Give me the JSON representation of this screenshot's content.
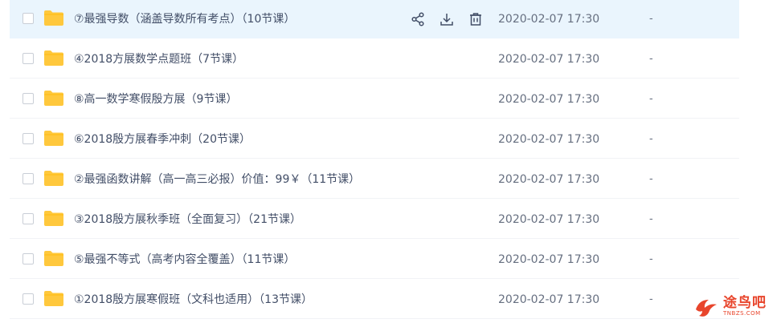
{
  "rows": [
    {
      "name": "⑦最强导数（涵盖导数所有考点）（10节课）",
      "date": "2020-02-07 17:30",
      "size": "-",
      "selected": true
    },
    {
      "name": "④2018方展数学点题班（7节课）",
      "date": "2020-02-07 17:30",
      "size": "-"
    },
    {
      "name": "⑧高一数学寒假殷方展（9节课）",
      "date": "2020-02-07 17:30",
      "size": "-"
    },
    {
      "name": "⑥2018殷方展春季冲刺（20节课）",
      "date": "2020-02-07 17:30",
      "size": "-"
    },
    {
      "name": "②最强函数讲解（高一高三必报）价值：99￥（11节课）",
      "date": "2020-02-07 17:30",
      "size": "-"
    },
    {
      "name": "③2018殷方展秋季班（全面复习）（21节课）",
      "date": "2020-02-07 17:30",
      "size": "-"
    },
    {
      "name": "⑤最强不等式（高考内容全覆盖）（11节课）",
      "date": "2020-02-07 17:30",
      "size": "-"
    },
    {
      "name": "①2018殷方展寒假班（文科也适用）（13节课）",
      "date": "2020-02-07 17:30",
      "size": "-"
    }
  ],
  "row_actions": {
    "icons": [
      "share-icon",
      "download-icon",
      "delete-icon"
    ]
  },
  "watermark": {
    "main": "途鸟吧",
    "sub": "TNBZS.COM"
  },
  "colors": {
    "selected_row": "#eaf5fd",
    "folder": "#ffc83d",
    "text": "#424e67",
    "meta_text": "#666f80",
    "watermark": "#e8452c"
  }
}
